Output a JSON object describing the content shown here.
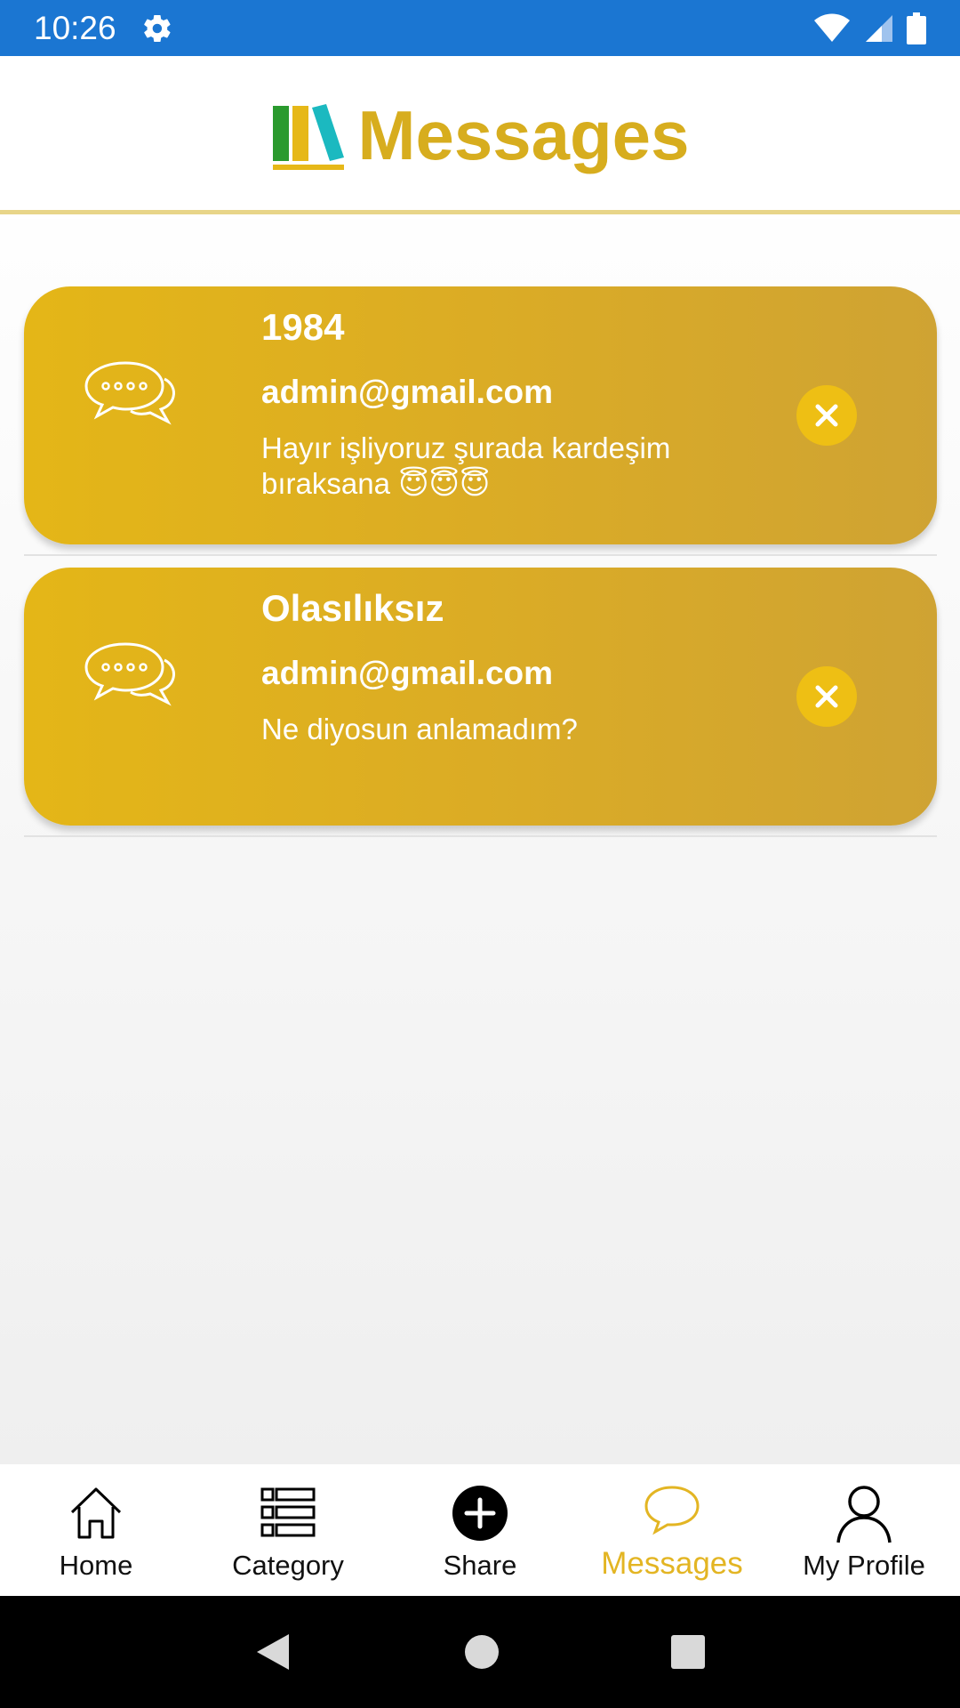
{
  "status_bar": {
    "time": "10:26",
    "icons": [
      "gear-icon",
      "wifi-icon",
      "signal-icon",
      "battery-icon"
    ]
  },
  "header": {
    "title": "Messages",
    "logo": "books-logo",
    "accent_color": "#d7ad1e"
  },
  "messages": [
    {
      "title": "1984",
      "email": "admin@gmail.com",
      "text": "Hayır işliyoruz şurada kardeşim bıraksana 😇😇😇"
    },
    {
      "title": "Olasılıksız",
      "email": "admin@gmail.com",
      "text": "Ne diyosun anlamadım?"
    }
  ],
  "bottom_nav": {
    "items": [
      {
        "label": "Home",
        "icon": "home-icon"
      },
      {
        "label": "Category",
        "icon": "list-icon"
      },
      {
        "label": "Share",
        "icon": "plus-circle-icon"
      },
      {
        "label": "Messages",
        "icon": "chat-bubble-icon",
        "active": true
      },
      {
        "label": "My Profile",
        "icon": "user-icon"
      }
    ],
    "active_color": "#e3b523"
  },
  "system_nav": {
    "icons": [
      "back-icon",
      "home-circle-icon",
      "recents-icon"
    ]
  }
}
